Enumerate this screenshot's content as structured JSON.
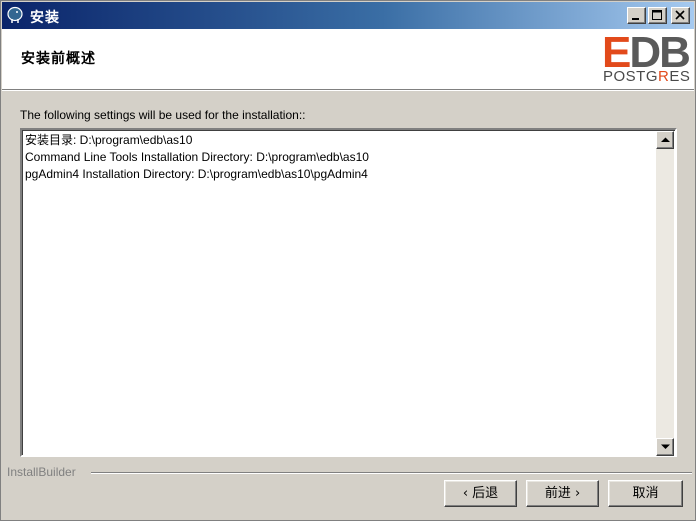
{
  "window": {
    "title": "安装",
    "icon": "postgres-elephant-icon",
    "controls": [
      "minimize-icon",
      "maximize-icon",
      "close-icon"
    ]
  },
  "header": {
    "title": "安装前概述",
    "logo_main": "EDB",
    "logo_sub": "POSTGRES",
    "accent_color": "#e24a1b"
  },
  "main": {
    "intro": "The following settings will be used for the installation::",
    "settings_lines": [
      "安装目录: D:\\program\\edb\\as10",
      "Command Line Tools Installation Directory: D:\\program\\edb\\as10",
      "pgAdmin4 Installation Directory: D:\\program\\edb\\as10\\pgAdmin4"
    ]
  },
  "footer": {
    "brand": "InstallBuilder",
    "back_label": "‹ 后退",
    "next_label": "前进 ›",
    "cancel_label": "取消"
  }
}
